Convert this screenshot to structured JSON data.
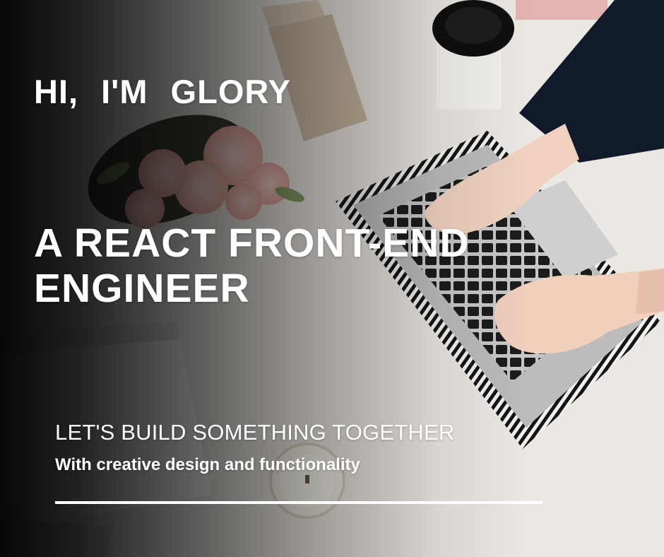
{
  "hero": {
    "greeting": "HI, I'M GLORY",
    "role": "A REACT FRONT-END ENGINEER",
    "tagline": "LET'S BUILD SOMETHING TOGETHER",
    "subline": "With creative design and functionality"
  },
  "background": {
    "description_icons": [
      "laptop-icon",
      "coffee-cup-icon",
      "flowers-icon",
      "candle-icon",
      "notebook-icon"
    ],
    "overlay_color": "#000000",
    "text_color": "#ffffff"
  }
}
